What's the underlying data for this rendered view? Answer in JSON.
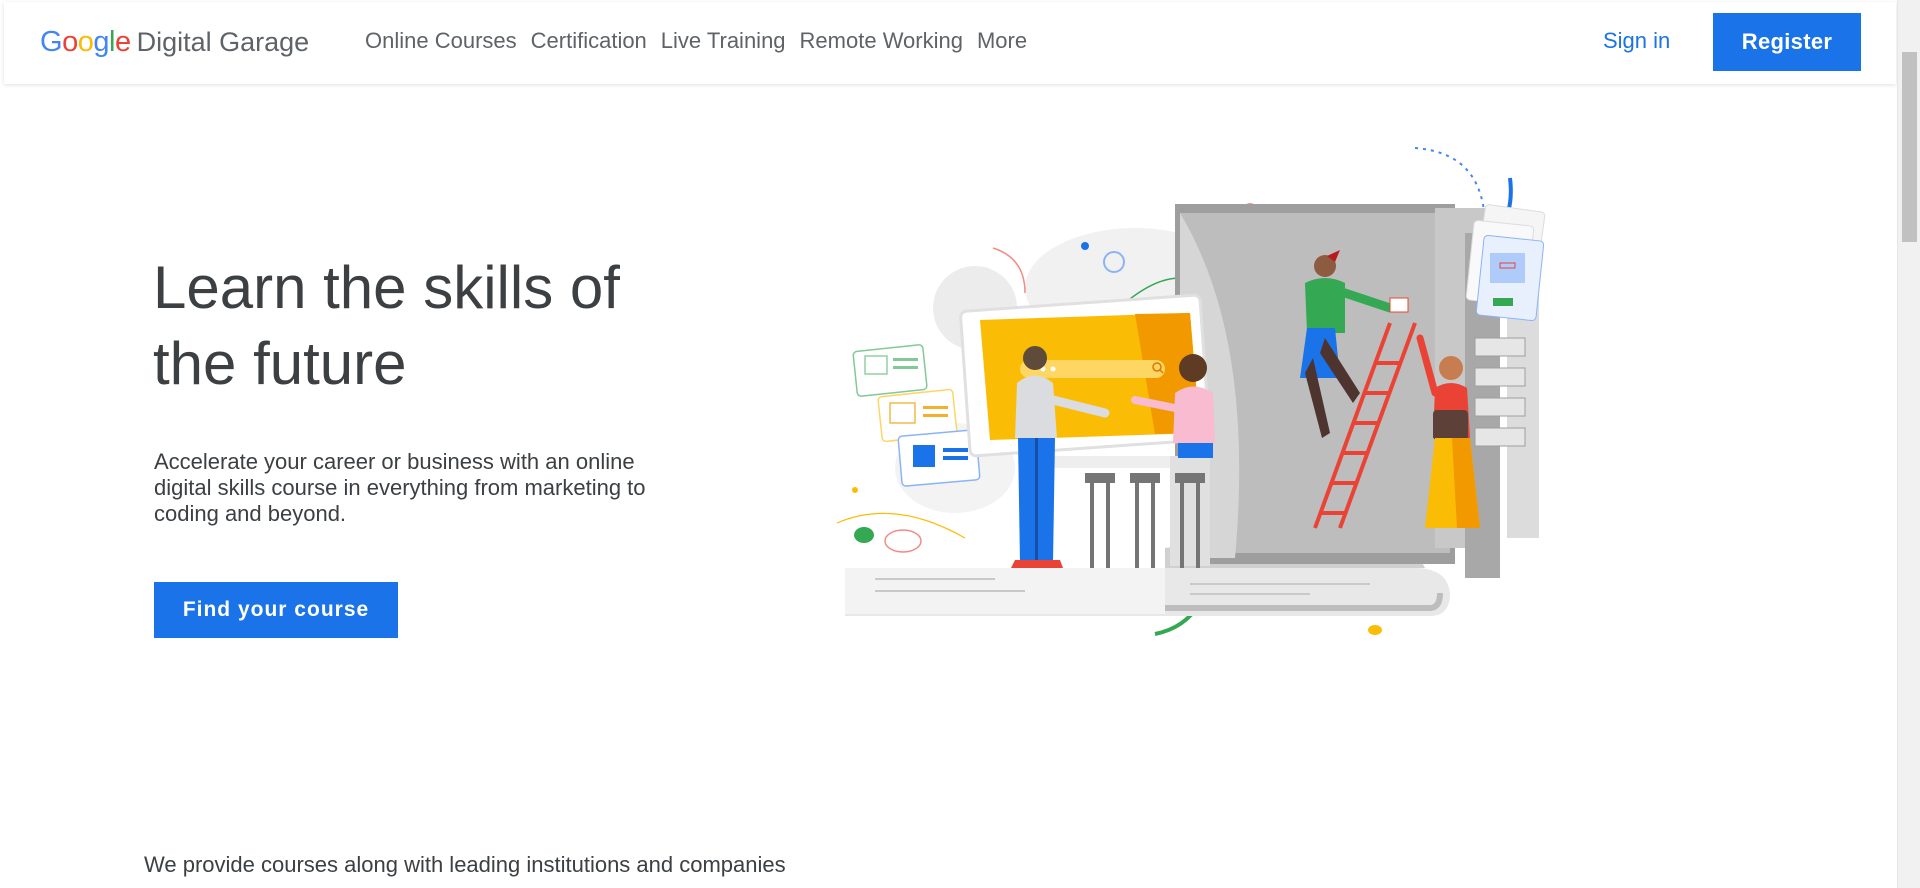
{
  "header": {
    "logo_google": "Google",
    "logo_product": "Digital Garage",
    "nav": [
      "Online Courses",
      "Certification",
      "Live Training",
      "Remote Working",
      "More"
    ],
    "signin_label": "Sign in",
    "register_label": "Register"
  },
  "hero": {
    "title": "Learn the skills of the future",
    "subtitle": "Accelerate your career or business with an online digital skills course in everything from marketing to coding and beyond.",
    "cta_label": "Find your course"
  },
  "providers_text": "We provide courses along with leading institutions and companies",
  "colors": {
    "brand_blue": "#1a73e8",
    "google_blue": "#4285f4",
    "google_red": "#ea4335",
    "google_yellow": "#fbbc05",
    "google_green": "#34a853"
  },
  "illustration": {
    "icon": "people-learning-illustration",
    "search_icon": "search-icon"
  }
}
